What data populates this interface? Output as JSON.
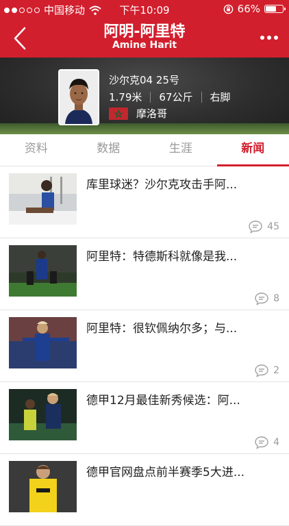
{
  "status_bar": {
    "carrier": "中国移动",
    "time": "下午10:09",
    "battery": "66%",
    "battery_level": 0.66,
    "signal_bars": 2
  },
  "header": {
    "title": "阿明-阿里特",
    "subtitle": "Amine Harit"
  },
  "player": {
    "team_number": "沙尔克04 25号",
    "height": "1.79米",
    "weight": "67公斤",
    "foot": "右脚",
    "nationality": "摩洛哥"
  },
  "tabs": [
    {
      "label": "资料",
      "active": false
    },
    {
      "label": "数据",
      "active": false
    },
    {
      "label": "生涯",
      "active": false
    },
    {
      "label": "新闻",
      "active": true
    }
  ],
  "news": [
    {
      "title": "库里球迷？沙尔克攻击手阿...",
      "comments": "45"
    },
    {
      "title": "阿里特：特德斯科就像是我...",
      "comments": "8"
    },
    {
      "title": "阿里特：很钦佩纳尔多；与...",
      "comments": "2"
    },
    {
      "title": "德甲12月最佳新秀候选：阿...",
      "comments": "4"
    },
    {
      "title": "德甲官网盘点前半赛季5大进...",
      "comments": ""
    }
  ],
  "colors": {
    "brand_red": "#d21f2d",
    "tab_inactive": "#9a9a9a"
  }
}
